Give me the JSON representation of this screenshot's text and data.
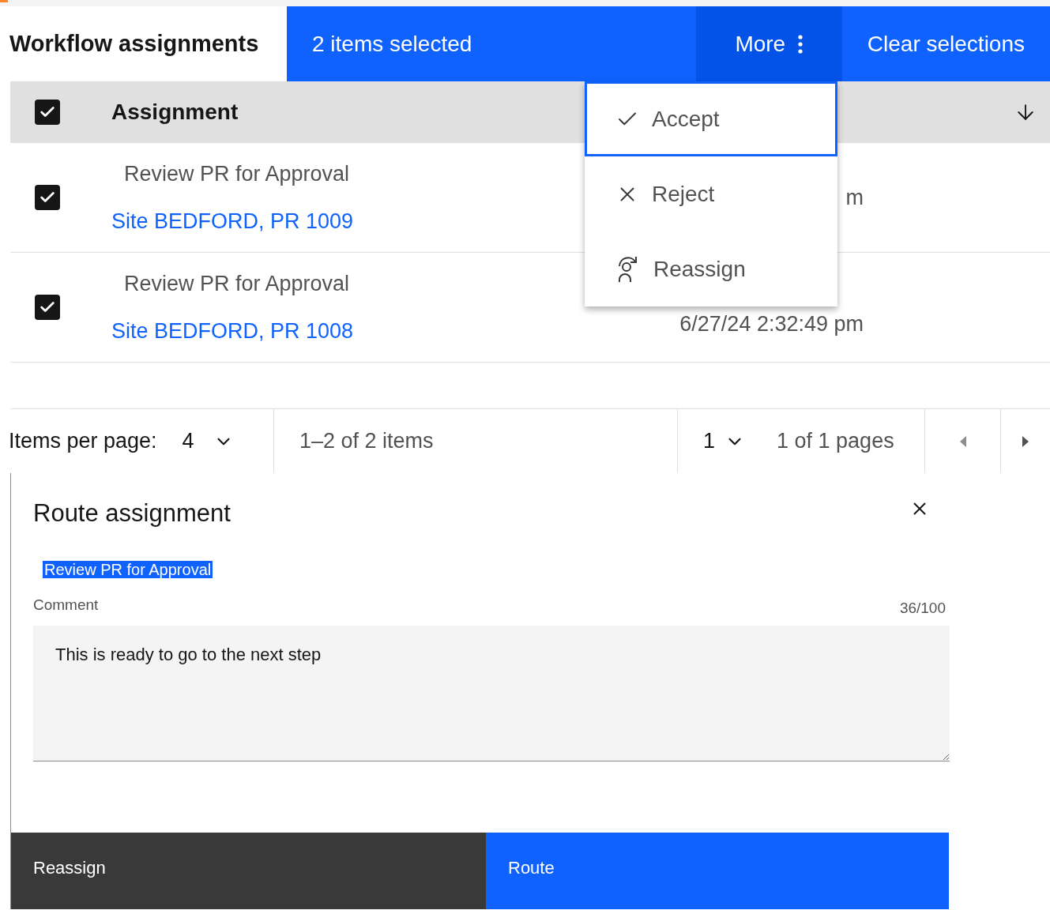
{
  "page_title": "Workflow assignments",
  "batch_bar": {
    "selected_count": "2 items selected",
    "more": "More",
    "clear": "Clear selections"
  },
  "menu": {
    "items": [
      {
        "kind": "accept",
        "label": "Accept",
        "selected": true
      },
      {
        "kind": "reject",
        "label": "Reject",
        "selected": false
      },
      {
        "kind": "reassign",
        "label": "Reassign",
        "selected": false
      }
    ]
  },
  "table": {
    "select_all_checked": true,
    "column": "Assignment",
    "rows": [
      {
        "checked": true,
        "title": "Review PR for Approval",
        "link": "Site BEDFORD, PR 1009",
        "column_2": "m"
      },
      {
        "checked": true,
        "title": "Review PR for Approval",
        "link": "Site BEDFORD, PR 1008",
        "column_2": "6/27/24 2:32:49 pm"
      }
    ]
  },
  "pagination": {
    "items_per_page_label": "Items per page:",
    "page_size": "4",
    "range": "1–2 of 2 items",
    "page": "1",
    "pages": "1 of 1 pages"
  },
  "panel": {
    "title": "Route assignment",
    "selected_text": "Review PR for Approval",
    "comment_label": "Comment",
    "counter": "36/100",
    "comment_value": "This is ready to go to the next step",
    "buttons": [
      {
        "kind": "secondary",
        "label": "Reassign"
      },
      {
        "kind": "primary",
        "label": "Route"
      }
    ]
  }
}
